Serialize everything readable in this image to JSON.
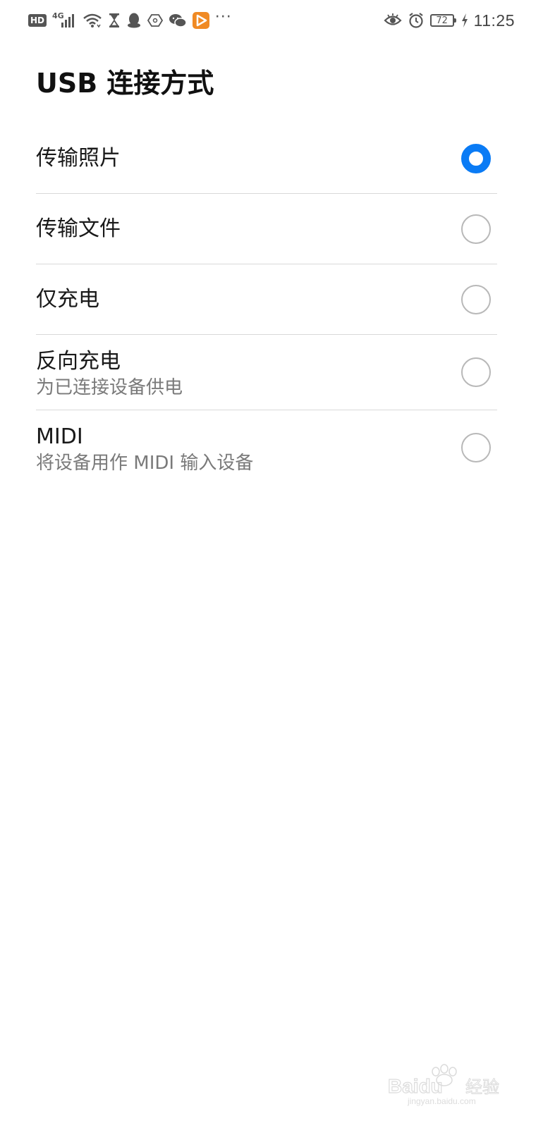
{
  "status_bar": {
    "left_icons": [
      "hd-badge",
      "signal-4g-icon",
      "wifi-icon",
      "hourglass-icon",
      "qq-icon",
      "hexagon-app-icon",
      "wechat-icon",
      "video-app-icon",
      "more-dots-icon"
    ],
    "hd_label": "HD",
    "network_type": "4G",
    "more_label": "···",
    "battery_level": "72",
    "time": "11:25",
    "right_icons": [
      "eye-icon",
      "alarm-icon",
      "battery-icon",
      "charging-icon"
    ]
  },
  "page": {
    "title": "USB 连接方式"
  },
  "options": [
    {
      "label": "传输照片",
      "subtitle": "",
      "selected": true
    },
    {
      "label": "传输文件",
      "subtitle": "",
      "selected": false
    },
    {
      "label": "仅充电",
      "subtitle": "",
      "selected": false
    },
    {
      "label": "反向充电",
      "subtitle": "为已连接设备供电",
      "selected": false
    },
    {
      "label": "MIDI",
      "subtitle": "将设备用作 MIDI 输入设备",
      "selected": false
    }
  ],
  "colors": {
    "accent": "#0a7bf5",
    "radio_border": "#b8b8b8",
    "divider": "#d9d9d9",
    "subtitle": "#7a7a7a"
  },
  "watermark": {
    "brand": "Baidu",
    "brand_cn": "经验",
    "domain": "jingyan.baidu.com"
  }
}
